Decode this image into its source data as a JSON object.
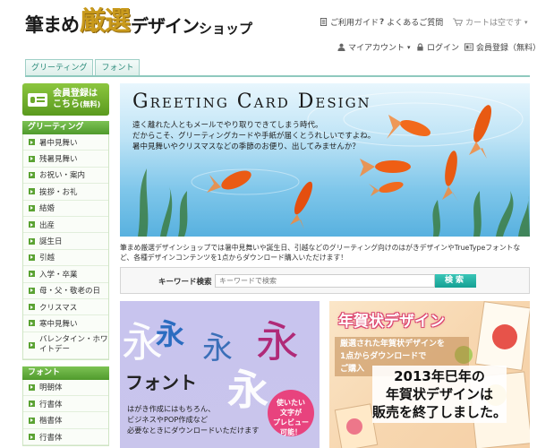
{
  "logo": {
    "part1": "筆まめ",
    "part2": "厳選",
    "part3": "デザイン",
    "part4": "ショップ"
  },
  "header": {
    "guide": "ご利用ガイド",
    "faq": "よくあるご質問",
    "cart": "カートは空です",
    "account": "マイアカウント",
    "login": "ログイン",
    "register": "会員登録（無料）"
  },
  "tabs": [
    "グリーティング",
    "フォント"
  ],
  "sidebar": {
    "register_line1": "会員登録は",
    "register_line2": "こちら",
    "register_free": "(無料)",
    "greeting_heading": "グリーティング",
    "greeting_items": [
      "暑中見舞い",
      "残暑見舞い",
      "お祝い・案内",
      "挨拶・お礼",
      "結婚",
      "出産",
      "誕生日",
      "引越",
      "入学・卒業",
      "母・父・敬老の日",
      "クリスマス",
      "寒中見舞い",
      "バレンタイン・ホワイトデー"
    ],
    "font_heading": "フォント",
    "font_items": [
      "明朝体",
      "行書体",
      "楷書体",
      "行書体"
    ]
  },
  "hero": {
    "title": "Greeting Card Design",
    "line1": "遠く離れた人ともメールでやり取りできてしまう時代。",
    "line2": "だからこそ、グリーティングカードや手紙が届くとうれしいですよね。",
    "line3": "暑中見舞いやクリスマスなどの季節のお便り、出してみませんか？"
  },
  "description": "筆まめ厳選デザインショップでは暑中見舞いや誕生日、引越などのグリーティング向けのはがきデザインやTrueTypeフォントなど、各種デザインコンテンツを1点からダウンロード購入いただけます！",
  "search": {
    "label": "キーワード検索",
    "placeholder": "キーワードで検索",
    "button": "検索"
  },
  "banner_font": {
    "title": "フォント",
    "line1": "はがき作成にはもちろん、",
    "line2": "ビジネスやPOP作成など",
    "line3": "必要なときにダウンロードいただけます",
    "badge1": "使いたい",
    "badge2": "文字が",
    "badge3": "プレビュー",
    "badge4": "可能！"
  },
  "banner_nenga": {
    "title": "年賀状デザイン",
    "sub1": "厳選された年賀状デザインを",
    "sub2": "1点からダウンロードで",
    "sub3": "ご購入",
    "notice1": "2013年巳年の",
    "notice2": "年賀状デザインは",
    "notice3": "販売を終了しました。"
  },
  "colors": {
    "accent_green": "#5aa232",
    "teal": "#15a094",
    "pink": "#e8437e"
  }
}
